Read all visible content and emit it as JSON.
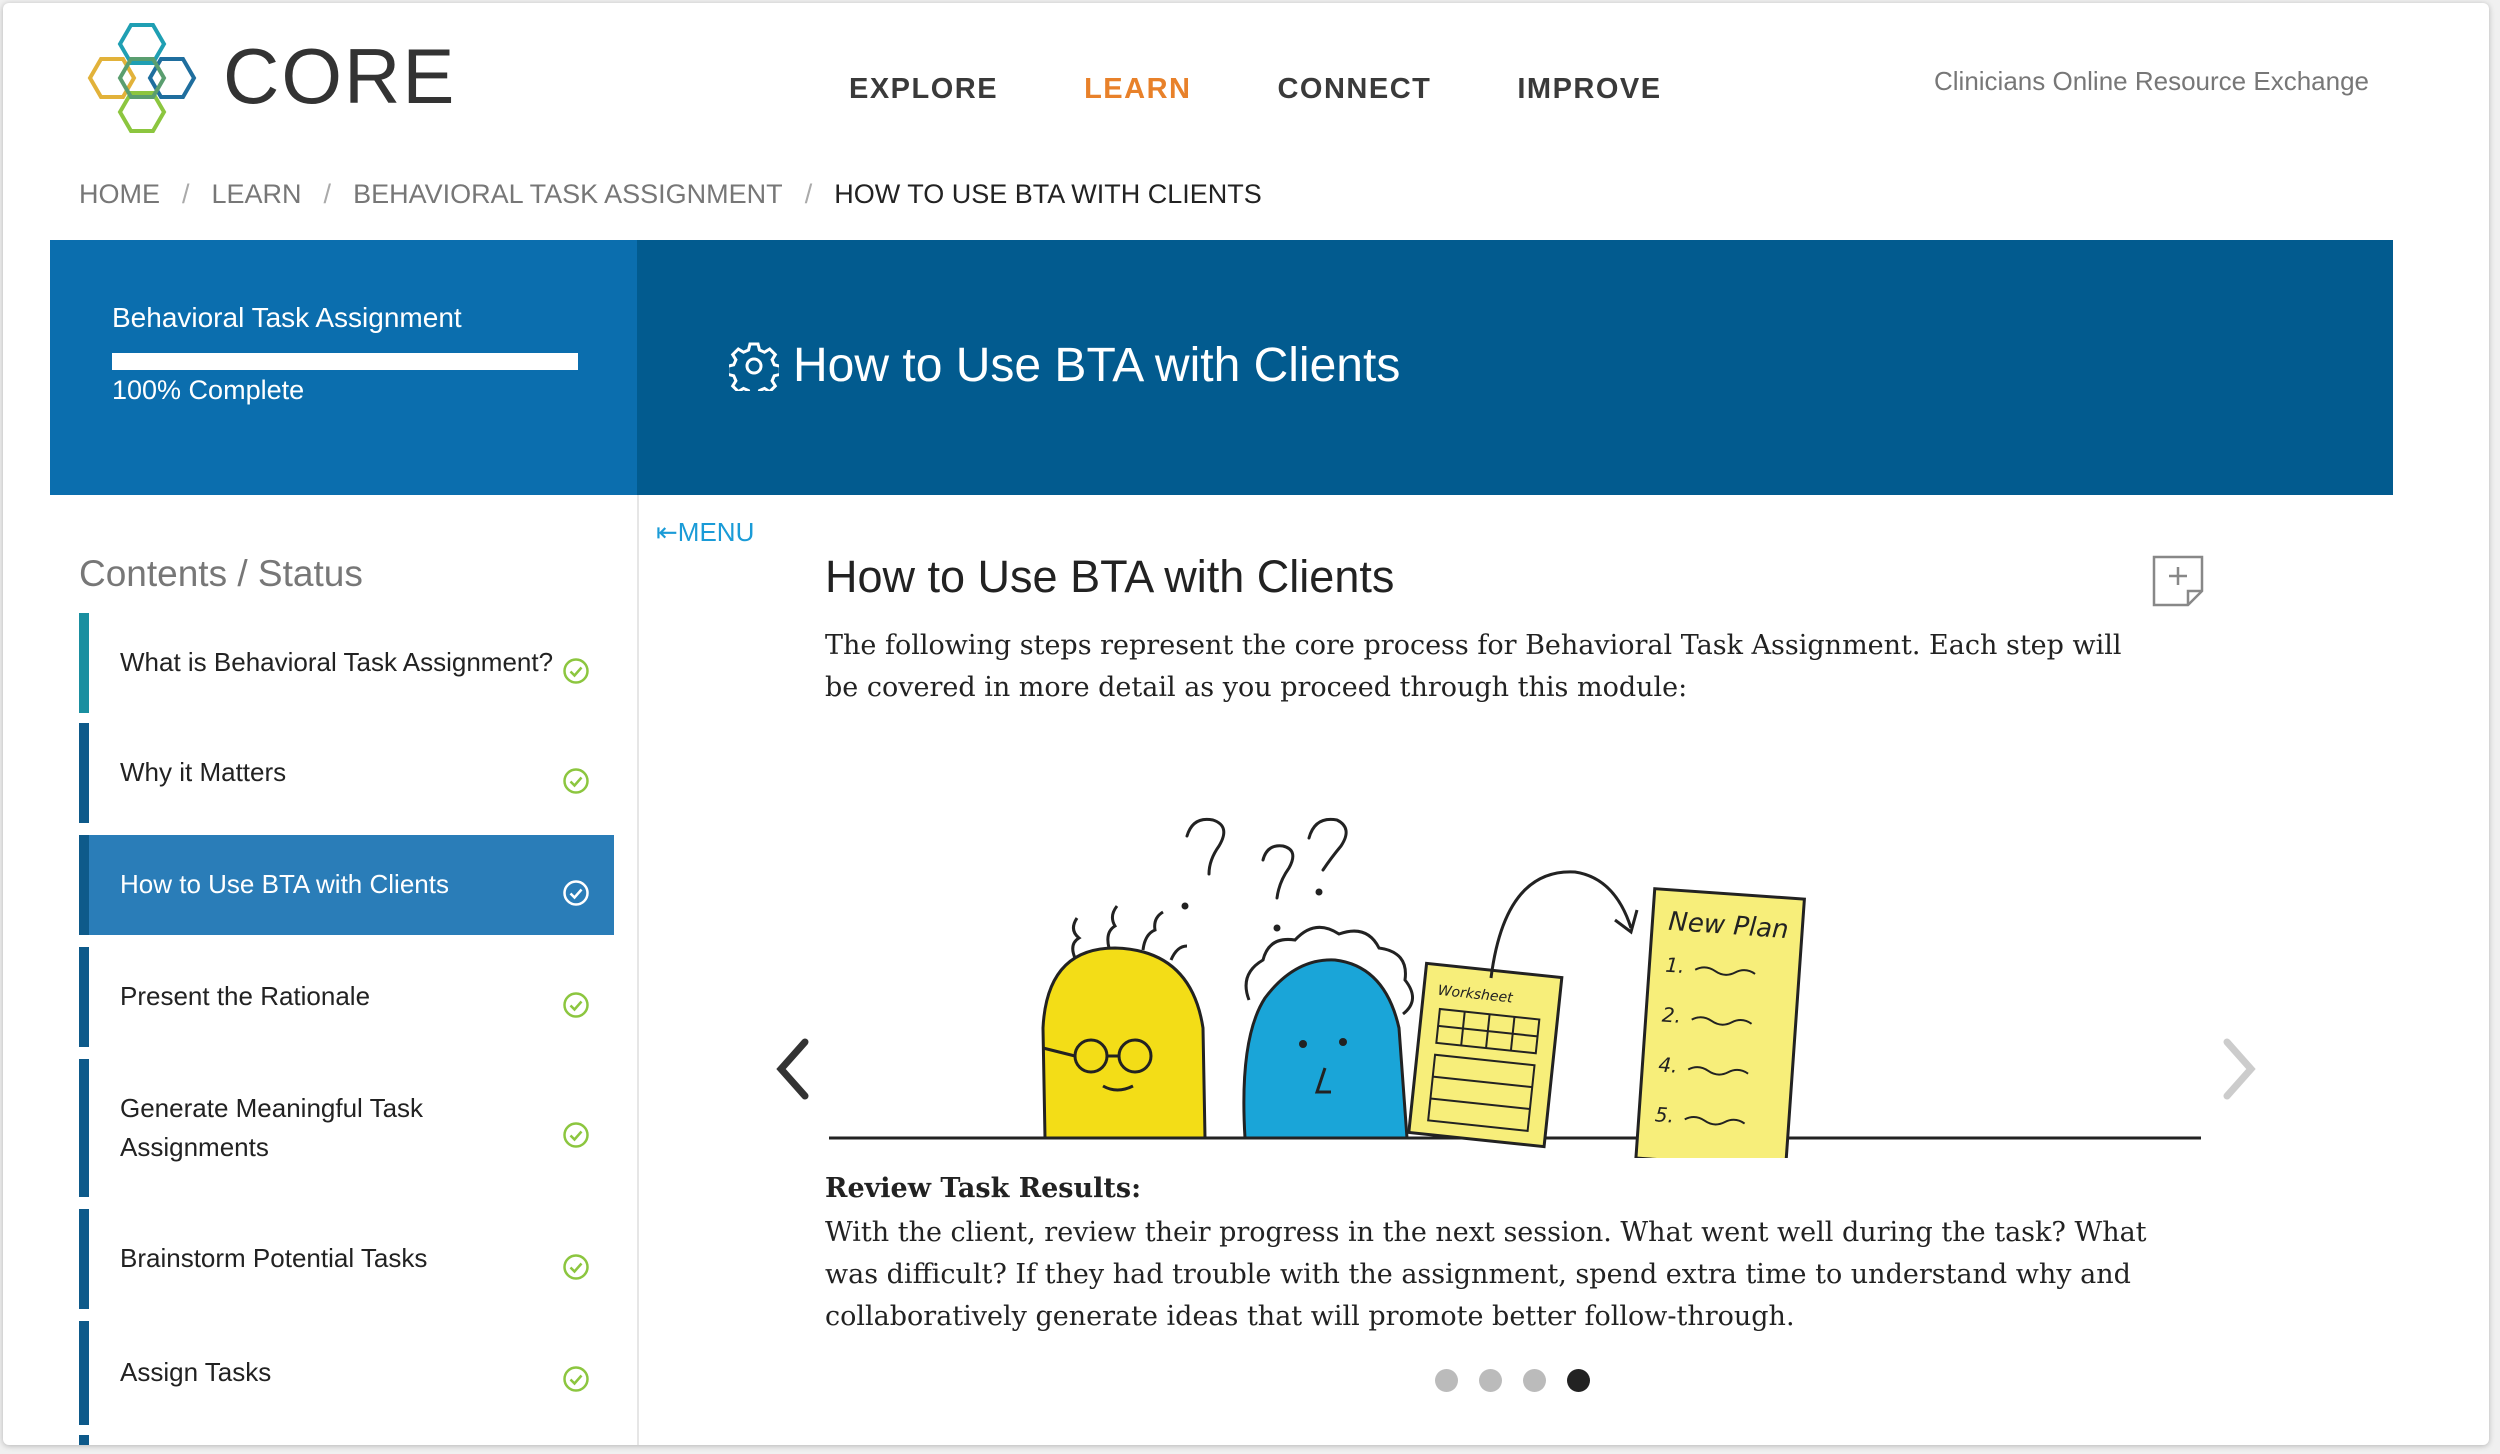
{
  "brand": {
    "name": "CORE",
    "tagline": "Clinicians Online Resource Exchange"
  },
  "nav": {
    "items": [
      {
        "label": "EXPLORE",
        "active": false
      },
      {
        "label": "LEARN",
        "active": true
      },
      {
        "label": "CONNECT",
        "active": false
      },
      {
        "label": "IMPROVE",
        "active": false
      }
    ]
  },
  "breadcrumb": [
    "HOME",
    "LEARN",
    "BEHAVIORAL TASK ASSIGNMENT",
    "HOW TO USE BTA WITH CLIENTS"
  ],
  "course": {
    "title": "Behavioral Task Assignment",
    "progress": 1.0,
    "progress_label": "100% Complete"
  },
  "page": {
    "heading": "How to Use BTA with Clients"
  },
  "sidebar": {
    "title": "Contents / Status",
    "items": [
      {
        "label": "What is Behavioral Task Assignment?",
        "status": "complete",
        "active": false
      },
      {
        "label": "Why it Matters",
        "status": "complete",
        "active": false
      },
      {
        "label": "How to Use BTA with Clients",
        "status": "complete",
        "active": true
      },
      {
        "label": "Present the Rationale",
        "status": "complete",
        "active": false
      },
      {
        "label": "Generate Meaningful Task Assignments",
        "status": "complete",
        "active": false
      },
      {
        "label": "Brainstorm Potential Tasks",
        "status": "complete",
        "active": false
      },
      {
        "label": "Assign Tasks",
        "status": "complete",
        "active": false
      }
    ]
  },
  "content": {
    "menu_toggle": "MENU",
    "title": "How to Use BTA with Clients",
    "intro": "The following steps represent the core process for Behavioral Task Assignment. Each step will be covered in more detail as you proceed through this module:",
    "slide": {
      "illustration_labels": {
        "worksheet": "Worksheet",
        "new_plan": "New Plan",
        "plan_items": [
          "1.",
          "2.",
          "4.",
          "5."
        ]
      },
      "caption_title": "Review Task Results:",
      "caption_body": "With the client, review their progress in the next session. What went well during the task? What was difficult? If they had trouble with the assignment, spend extra time to understand why and collaboratively generate ideas that will promote better follow-through."
    },
    "carousel": {
      "count": 4,
      "active_index": 3
    }
  },
  "colors": {
    "accent_orange": "#e8812a",
    "banner_dark": "#025b8f",
    "banner_light": "#0b6eae",
    "check_green": "#8cc63f",
    "link_blue": "#1a9bd7"
  },
  "icons": {
    "heading": "gear-icon",
    "status": "check-circle-icon",
    "note": "add-note-icon",
    "prev": "chevron-left-icon",
    "next": "chevron-right-icon"
  }
}
